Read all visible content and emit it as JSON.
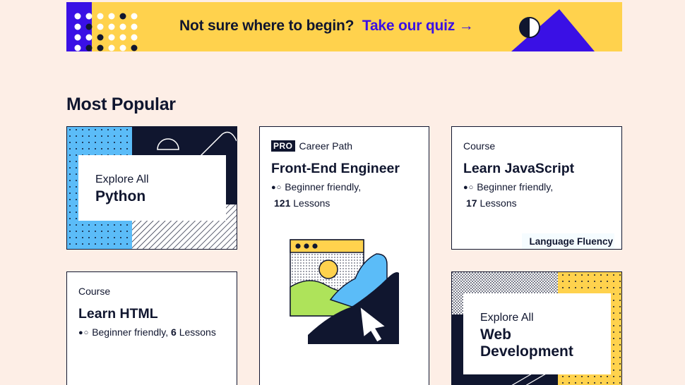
{
  "banner": {
    "lead_text": "Not sure where to begin?",
    "link_text": "Take our quiz →"
  },
  "section": {
    "title": "Most Popular"
  },
  "cards": {
    "python": {
      "small": "Explore All",
      "big": "Python"
    },
    "frontend": {
      "pro_badge": "PRO",
      "kicker": "Career Path",
      "title": "Front-End Engineer",
      "difficulty_icon": "●○",
      "difficulty": "Beginner friendly",
      "lessons_count": "121",
      "lessons_label": "Lessons"
    },
    "javascript": {
      "kicker": "Course",
      "title": "Learn JavaScript",
      "difficulty_icon": "●○",
      "difficulty": "Beginner friendly",
      "lessons_count": "17",
      "lessons_label": "Lessons",
      "badge": "Language Fluency"
    },
    "html": {
      "kicker": "Course",
      "title": "Learn HTML",
      "difficulty_icon": "●○",
      "difficulty": "Beginner friendly",
      "lessons_count": "6",
      "lessons_label": "Lessons"
    },
    "webdev": {
      "small": "Explore All",
      "big_line1": "Web",
      "big_line2": "Development"
    }
  },
  "colors": {
    "background": "#fdeee6",
    "navy": "#10162f",
    "yellow": "#ffd24d",
    "purple": "#3a10e5",
    "blue": "#5bbcf8",
    "green": "#aee35a"
  }
}
